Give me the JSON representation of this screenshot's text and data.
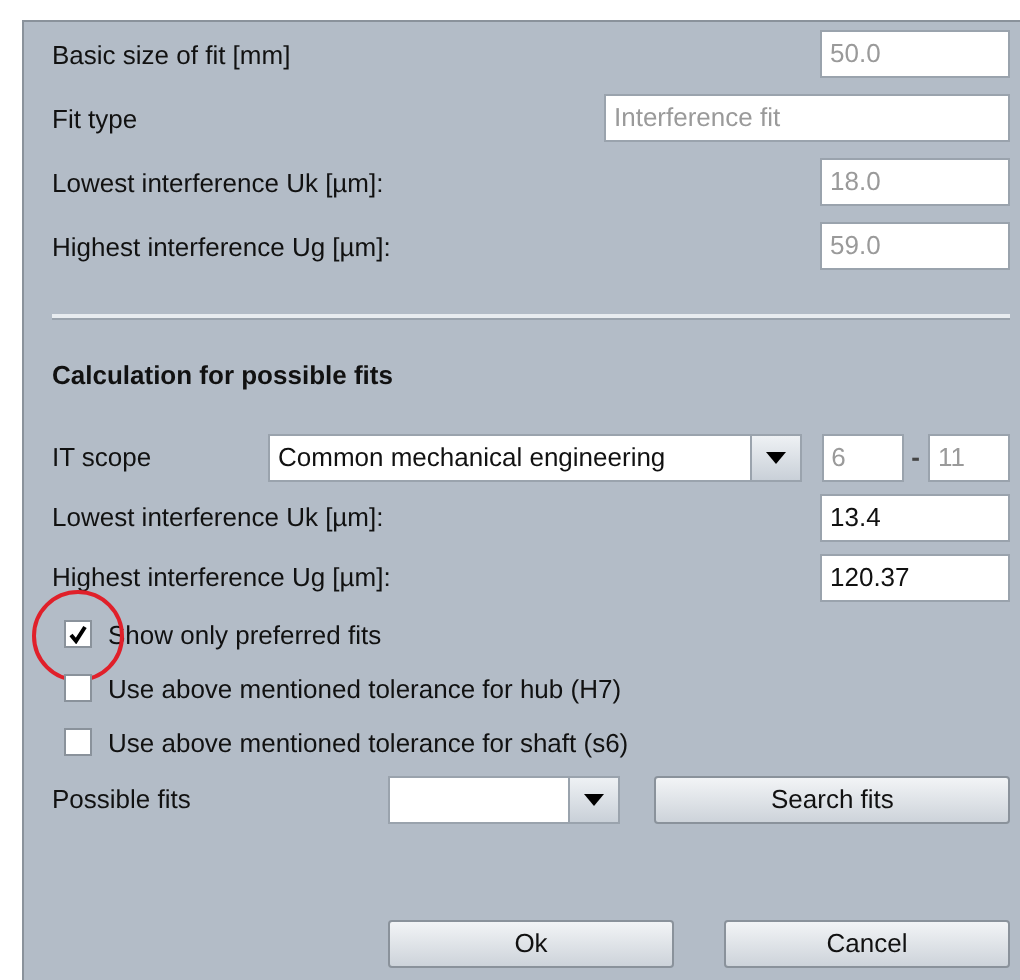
{
  "fit_info": [
    {
      "label": "Basic size of fit [mm]",
      "value": "50.0",
      "disabled": true,
      "kind": "short"
    },
    {
      "label": "Fit type",
      "value": "Interference fit",
      "disabled": true,
      "kind": "wide"
    },
    {
      "label": "Lowest interference Uk [µm]:",
      "value": "18.0",
      "disabled": true,
      "kind": "short"
    },
    {
      "label": "Highest interference Ug [µm]:",
      "value": "59.0",
      "disabled": true,
      "kind": "short"
    }
  ],
  "calculation": {
    "heading": "Calculation for possible fits",
    "it_scope": {
      "label": "IT scope",
      "selection": "Common mechanical engineering",
      "from": "6",
      "separator": "-",
      "to": "11",
      "range_disabled": true
    },
    "fields": [
      {
        "label": "Lowest interference Uk [µm]:",
        "value": "13.4",
        "disabled": false
      },
      {
        "label": "Highest interference Ug [µm]:",
        "value": "120.37",
        "disabled": false
      }
    ],
    "options": [
      {
        "label": "Show only preferred fits",
        "checked": true,
        "circled": true
      },
      {
        "label": "Use above mentioned tolerance for hub (H7)",
        "checked": false,
        "circled": false
      },
      {
        "label": "Use above mentioned tolerance for shaft (s6)",
        "checked": false,
        "circled": false
      }
    ],
    "possible_fits": {
      "label": "Possible fits",
      "button": "Search fits"
    }
  },
  "buttons": [
    "Ok",
    "Cancel"
  ]
}
